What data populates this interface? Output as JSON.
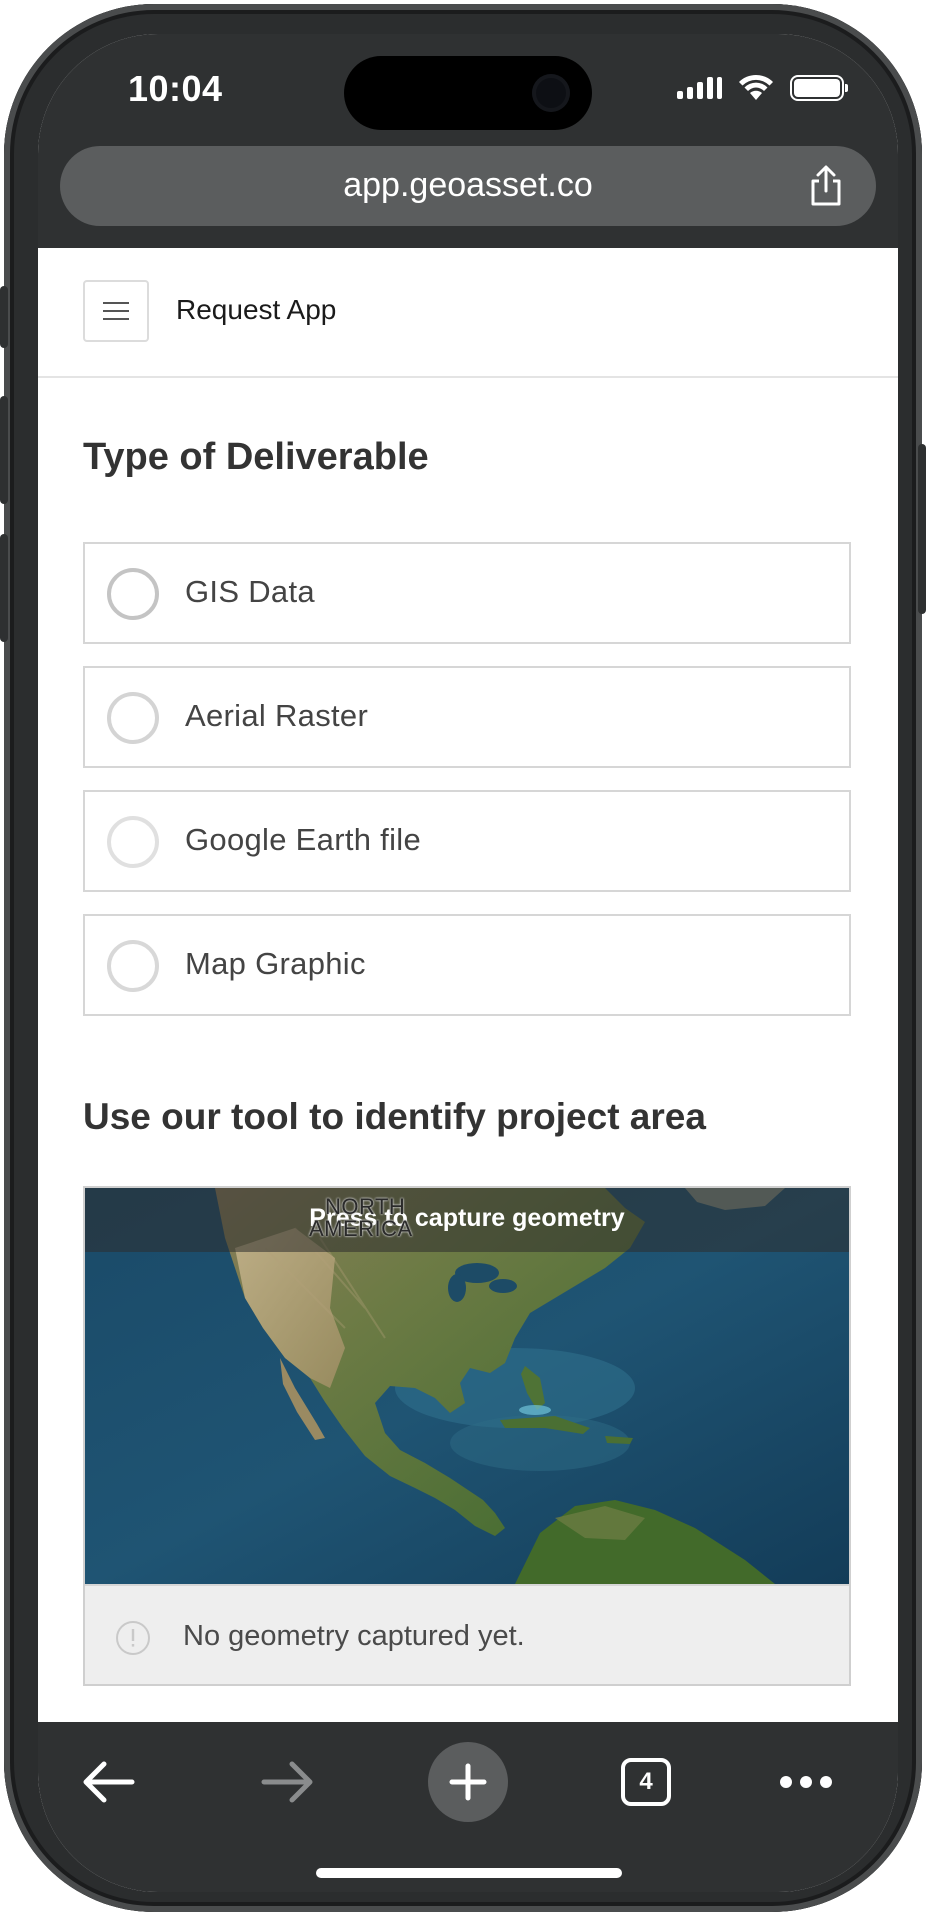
{
  "status_bar": {
    "time": "10:04"
  },
  "browser": {
    "url": "app.geoasset.co",
    "tab_count": "4"
  },
  "app": {
    "title": "Request App"
  },
  "deliverable": {
    "title": "Type of Deliverable",
    "options": [
      {
        "label": "GIS Data"
      },
      {
        "label": "Aerial Raster"
      },
      {
        "label": "Google Earth file"
      },
      {
        "label": "Map Graphic"
      }
    ]
  },
  "project_area": {
    "title": "Use our tool to identify project area",
    "map_banner": "Press to capture geometry",
    "map_label_line1": "NORTH",
    "map_label_line2": "AMERICA",
    "geometry_status": "No geometry captured yet."
  },
  "icons": {
    "share": "share-icon",
    "menu": "hamburger-icon",
    "back": "arrow-left-icon",
    "forward": "arrow-right-icon",
    "new_tab": "plus-icon",
    "tabs": "tabs-icon",
    "more": "more-icon",
    "info": "info-icon"
  },
  "colors": {
    "chrome": "#2f3132",
    "url_bar": "#5b5d5e",
    "ocean": "#1d4b66",
    "land": "#5e7a3e"
  }
}
